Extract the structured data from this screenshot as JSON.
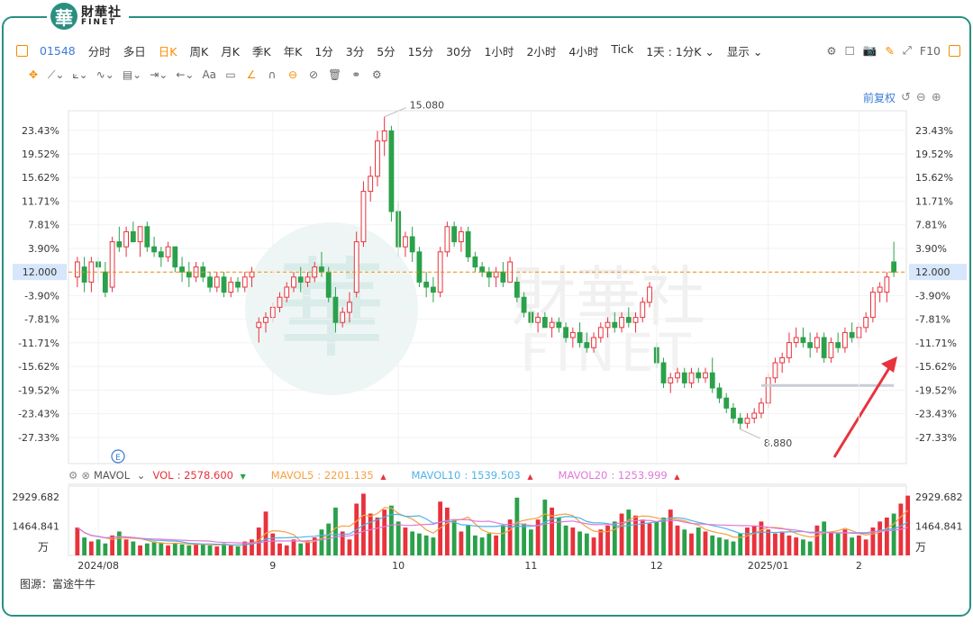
{
  "brand": {
    "logo_char": "華",
    "name": "財華社",
    "sub": "FINET"
  },
  "toolbar": {
    "code": "01548",
    "periods": [
      {
        "label": "分时",
        "active": false
      },
      {
        "label": "多日",
        "active": false
      },
      {
        "label": "日K",
        "active": true
      },
      {
        "label": "周K",
        "active": false
      },
      {
        "label": "月K",
        "active": false
      },
      {
        "label": "季K",
        "active": false
      },
      {
        "label": "年K",
        "active": false
      },
      {
        "label": "1分",
        "active": false
      },
      {
        "label": "3分",
        "active": false
      },
      {
        "label": "5分",
        "active": false
      },
      {
        "label": "15分",
        "active": false
      },
      {
        "label": "30分",
        "active": false
      },
      {
        "label": "1小时",
        "active": false
      },
      {
        "label": "2小时",
        "active": false
      },
      {
        "label": "4小时",
        "active": false
      },
      {
        "label": "Tick",
        "active": false
      }
    ],
    "multi_period": "1天 : 1分K",
    "display": "显示",
    "f10": "F10"
  },
  "adjust_label": "前复权",
  "colors": {
    "up": "#e8323c",
    "down": "#2aa14a",
    "ma5": "#f5a142",
    "ma10": "#4fb3e8",
    "ma20": "#e07ad8",
    "accent": "#f08c00",
    "brand": "#2a8f80"
  },
  "chart_data": [
    {
      "type": "candlestick",
      "x_tick_labels": [
        "2024/08",
        "9",
        "10",
        "11",
        "12",
        "2025/01",
        "2"
      ],
      "y_tick_labels": [
        "23.43%",
        "19.52%",
        "15.62%",
        "11.71%",
        "7.81%",
        "3.90%",
        "0.00%",
        "-3.90%",
        "-7.81%",
        "-11.71%",
        "-15.62%",
        "-19.52%",
        "-23.43%",
        "-27.33%"
      ],
      "reference_price": 12.0,
      "ylim": [
        8.2,
        15.2
      ],
      "current_price_label": "12.000",
      "high_annotation": {
        "value": 15.08,
        "label": "15.080"
      },
      "low_annotation": {
        "value": 8.88,
        "label": "8.880"
      },
      "event_marker": "E",
      "ohlc": [
        [
          11.9,
          12.3,
          11.7,
          12.2
        ],
        [
          12.1,
          12.3,
          11.6,
          11.8
        ],
        [
          11.8,
          12.3,
          11.6,
          12.2
        ],
        [
          12.2,
          12.3,
          11.8,
          12.1
        ],
        [
          12.0,
          12.2,
          11.5,
          11.6
        ],
        [
          11.7,
          12.7,
          11.6,
          12.6
        ],
        [
          12.6,
          12.9,
          12.4,
          12.5
        ],
        [
          12.5,
          12.9,
          12.3,
          12.8
        ],
        [
          12.8,
          13.0,
          12.6,
          12.6
        ],
        [
          12.6,
          12.9,
          12.3,
          12.9
        ],
        [
          12.9,
          13.0,
          12.4,
          12.5
        ],
        [
          12.5,
          12.7,
          12.3,
          12.4
        ],
        [
          12.4,
          12.5,
          12.1,
          12.3
        ],
        [
          12.3,
          12.6,
          12.2,
          12.5
        ],
        [
          12.5,
          12.5,
          12.0,
          12.1
        ],
        [
          12.1,
          12.3,
          11.8,
          12.0
        ],
        [
          12.0,
          12.2,
          11.7,
          11.9
        ],
        [
          11.9,
          12.2,
          11.8,
          12.1
        ],
        [
          12.1,
          12.2,
          11.8,
          11.9
        ],
        [
          11.9,
          12.0,
          11.6,
          11.7
        ],
        [
          11.7,
          12.0,
          11.6,
          11.9
        ],
        [
          11.9,
          12.0,
          11.5,
          11.6
        ],
        [
          11.6,
          11.9,
          11.5,
          11.8
        ],
        [
          11.8,
          11.9,
          11.6,
          11.7
        ],
        [
          11.7,
          12.0,
          11.6,
          11.9
        ],
        [
          11.9,
          12.1,
          11.7,
          12.0
        ],
        [
          10.9,
          11.1,
          10.6,
          11.0
        ],
        [
          11.0,
          11.2,
          10.8,
          11.1
        ],
        [
          11.1,
          11.4,
          11.0,
          11.3
        ],
        [
          11.3,
          11.6,
          11.2,
          11.5
        ],
        [
          11.5,
          11.8,
          11.4,
          11.7
        ],
        [
          11.7,
          12.0,
          11.6,
          11.9
        ],
        [
          11.9,
          12.1,
          11.6,
          11.8
        ],
        [
          11.8,
          12.0,
          11.7,
          11.9
        ],
        [
          11.9,
          12.2,
          11.8,
          12.1
        ],
        [
          12.1,
          12.4,
          11.9,
          12.0
        ],
        [
          12.0,
          12.1,
          11.4,
          11.5
        ],
        [
          11.5,
          11.7,
          10.8,
          11.0
        ],
        [
          11.0,
          11.3,
          10.9,
          11.2
        ],
        [
          11.2,
          11.6,
          11.0,
          11.4
        ],
        [
          11.6,
          12.8,
          11.5,
          12.6
        ],
        [
          12.6,
          13.8,
          12.5,
          13.6
        ],
        [
          13.6,
          14.1,
          13.4,
          13.9
        ],
        [
          13.9,
          14.8,
          13.7,
          14.6
        ],
        [
          14.6,
          15.08,
          14.3,
          14.8
        ],
        [
          14.8,
          14.9,
          13.0,
          13.2
        ],
        [
          13.2,
          13.4,
          12.3,
          12.5
        ],
        [
          12.5,
          12.8,
          12.3,
          12.7
        ],
        [
          12.7,
          12.9,
          12.2,
          12.4
        ],
        [
          12.4,
          12.5,
          11.7,
          11.8
        ],
        [
          11.8,
          12.0,
          11.5,
          11.7
        ],
        [
          11.7,
          11.9,
          11.4,
          11.6
        ],
        [
          11.6,
          12.5,
          11.5,
          12.4
        ],
        [
          12.4,
          13.0,
          12.3,
          12.9
        ],
        [
          12.9,
          13.0,
          12.5,
          12.6
        ],
        [
          12.6,
          12.9,
          12.4,
          12.8
        ],
        [
          12.8,
          12.9,
          12.2,
          12.3
        ],
        [
          12.3,
          12.4,
          12.0,
          12.1
        ],
        [
          12.1,
          12.2,
          11.9,
          12.0
        ],
        [
          12.0,
          12.1,
          11.7,
          11.9
        ],
        [
          11.9,
          12.1,
          11.7,
          12.0
        ],
        [
          12.0,
          12.2,
          11.7,
          11.8
        ],
        [
          11.8,
          12.3,
          11.8,
          12.2
        ],
        [
          11.8,
          11.9,
          11.4,
          11.5
        ],
        [
          11.5,
          11.6,
          11.1,
          11.2
        ],
        [
          11.2,
          11.3,
          10.9,
          11.0
        ],
        [
          11.0,
          11.2,
          10.8,
          11.1
        ],
        [
          11.1,
          11.2,
          10.9,
          10.9
        ],
        [
          10.9,
          11.1,
          10.7,
          11.0
        ],
        [
          11.0,
          11.1,
          10.8,
          10.9
        ],
        [
          10.9,
          11.0,
          10.6,
          10.7
        ],
        [
          10.7,
          10.9,
          10.5,
          10.8
        ],
        [
          10.8,
          11.0,
          10.5,
          10.6
        ],
        [
          10.6,
          10.8,
          10.4,
          10.5
        ],
        [
          10.5,
          10.8,
          10.4,
          10.7
        ],
        [
          10.7,
          11.0,
          10.6,
          10.9
        ],
        [
          10.9,
          11.1,
          10.7,
          11.0
        ],
        [
          11.0,
          11.2,
          10.8,
          10.9
        ],
        [
          10.9,
          11.2,
          10.8,
          11.1
        ],
        [
          11.1,
          11.3,
          10.9,
          11.0
        ],
        [
          11.0,
          11.2,
          10.8,
          11.1
        ],
        [
          11.1,
          11.5,
          11.0,
          11.4
        ],
        [
          11.4,
          11.8,
          11.3,
          11.7
        ],
        [
          10.5,
          10.6,
          10.1,
          10.2
        ],
        [
          10.2,
          10.3,
          9.7,
          9.8
        ],
        [
          9.8,
          10.0,
          9.6,
          9.9
        ],
        [
          9.9,
          10.1,
          9.8,
          10.0
        ],
        [
          10.0,
          10.1,
          9.7,
          9.8
        ],
        [
          9.8,
          10.1,
          9.7,
          10.0
        ],
        [
          10.0,
          10.1,
          9.8,
          9.9
        ],
        [
          9.9,
          10.1,
          9.8,
          10.0
        ],
        [
          10.0,
          10.3,
          9.6,
          9.7
        ],
        [
          9.7,
          9.8,
          9.4,
          9.5
        ],
        [
          9.5,
          9.6,
          9.2,
          9.3
        ],
        [
          9.3,
          9.4,
          9.0,
          9.1
        ],
        [
          9.1,
          9.2,
          8.88,
          9.0
        ],
        [
          9.0,
          9.2,
          8.9,
          9.1
        ],
        [
          9.1,
          9.3,
          9.0,
          9.2
        ],
        [
          9.2,
          9.5,
          9.1,
          9.4
        ],
        [
          9.4,
          10.0,
          9.3,
          9.9
        ],
        [
          9.9,
          10.3,
          9.8,
          10.2
        ],
        [
          10.2,
          10.4,
          10.0,
          10.3
        ],
        [
          10.3,
          10.8,
          10.2,
          10.6
        ],
        [
          10.6,
          10.9,
          10.5,
          10.7
        ],
        [
          10.7,
          10.9,
          10.5,
          10.6
        ],
        [
          10.6,
          10.8,
          10.3,
          10.5
        ],
        [
          10.5,
          10.8,
          10.4,
          10.7
        ],
        [
          10.7,
          10.8,
          10.2,
          10.3
        ],
        [
          10.3,
          10.7,
          10.2,
          10.6
        ],
        [
          10.6,
          10.8,
          10.4,
          10.5
        ],
        [
          10.5,
          10.9,
          10.4,
          10.8
        ],
        [
          10.8,
          11.0,
          10.6,
          10.7
        ],
        [
          10.7,
          11.0,
          10.5,
          10.9
        ],
        [
          10.9,
          11.2,
          10.8,
          11.1
        ],
        [
          11.1,
          11.7,
          11.0,
          11.6
        ],
        [
          11.6,
          11.8,
          11.4,
          11.7
        ],
        [
          11.6,
          12.0,
          11.4,
          11.9
        ],
        [
          12.2,
          12.6,
          11.9,
          12.0
        ]
      ]
    },
    {
      "type": "bar",
      "indicator": "MAVOL",
      "legend": [
        {
          "name": "VOL",
          "value": "2578.600",
          "marker": "down"
        },
        {
          "name": "MAVOL5",
          "value": "2201.135",
          "marker": "up"
        },
        {
          "name": "MAVOL10",
          "value": "1539.503",
          "marker": "up"
        },
        {
          "name": "MAVOL20",
          "value": "1253.999",
          "marker": "up"
        }
      ],
      "y_tick_labels": [
        "2929.682",
        "1464.841"
      ],
      "unit": "万",
      "ylim": [
        0,
        3300
      ],
      "volumes": [
        1400,
        900,
        700,
        800,
        600,
        1000,
        1200,
        800,
        700,
        500,
        600,
        700,
        650,
        500,
        600,
        550,
        500,
        600,
        550,
        500,
        450,
        600,
        500,
        450,
        700,
        800,
        1400,
        2200,
        1100,
        600,
        500,
        800,
        600,
        700,
        900,
        1300,
        1600,
        2400,
        1200,
        800,
        2600,
        3100,
        2100,
        1900,
        2300,
        2500,
        1700,
        1400,
        1200,
        1100,
        1000,
        900,
        2700,
        2400,
        1800,
        1200,
        1500,
        1000,
        900,
        1100,
        1000,
        1500,
        1800,
        2900,
        1600,
        1300,
        1800,
        2800,
        2400,
        1900,
        1500,
        1400,
        1200,
        1100,
        900,
        1300,
        1500,
        1700,
        2100,
        2300,
        2000,
        1800,
        1600,
        1700,
        1900,
        2300,
        1500,
        1300,
        1100,
        1400,
        1200,
        1000,
        900,
        800,
        700,
        1100,
        1400,
        1500,
        1700,
        1300,
        1100,
        1200,
        1000,
        900,
        800,
        700,
        1500,
        1700,
        1200,
        1100,
        1300,
        900,
        1000,
        800,
        1400,
        1700,
        1900,
        2100,
        2600,
        3000
      ]
    }
  ],
  "source_label": "图源：富途牛牛"
}
